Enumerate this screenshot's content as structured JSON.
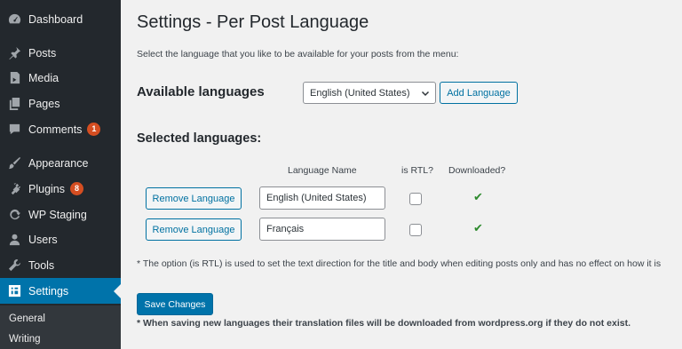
{
  "sidebar": {
    "items": [
      {
        "label": "Dashboard",
        "icon": "dashboard-icon"
      },
      {
        "label": "Posts",
        "icon": "pin-icon"
      },
      {
        "label": "Media",
        "icon": "media-icon"
      },
      {
        "label": "Pages",
        "icon": "pages-icon"
      },
      {
        "label": "Comments",
        "icon": "comment-icon",
        "badge": "1"
      },
      {
        "label": "Appearance",
        "icon": "brush-icon"
      },
      {
        "label": "Plugins",
        "icon": "plug-icon",
        "badge": "8"
      },
      {
        "label": "WP Staging",
        "icon": "refresh-icon"
      },
      {
        "label": "Users",
        "icon": "user-icon"
      },
      {
        "label": "Tools",
        "icon": "wrench-icon"
      },
      {
        "label": "Settings",
        "icon": "settings-icon"
      }
    ],
    "submenu": [
      "General",
      "Writing"
    ]
  },
  "page": {
    "title": "Settings - Per Post Language",
    "intro": "Select the language that you like to be available for your posts from the menu:",
    "available_label": "Available languages",
    "select_value": "English (United States)",
    "add_button": "Add Language",
    "selected_label": "Selected languages:",
    "columns": [
      "Language Name",
      "is RTL?",
      "Downloaded?"
    ],
    "rows": [
      {
        "remove": "Remove Language",
        "name": "English (United States)",
        "rtl": false,
        "downloaded": "✔"
      },
      {
        "remove": "Remove Language",
        "name": "Français",
        "rtl": false,
        "downloaded": "✔"
      }
    ],
    "note": "* The option (is RTL) is used to set the text direction for the title and body when editing posts only and has no effect on how it is",
    "save_button": "Save Changes",
    "save_note": "* When saving new languages their translation files will be downloaded from wordpress.org if they do not exist."
  },
  "colors": {
    "sidebar_bg": "#23282d",
    "accent": "#0073aa",
    "badge": "#d54e21",
    "check": "#2d8a2d"
  }
}
